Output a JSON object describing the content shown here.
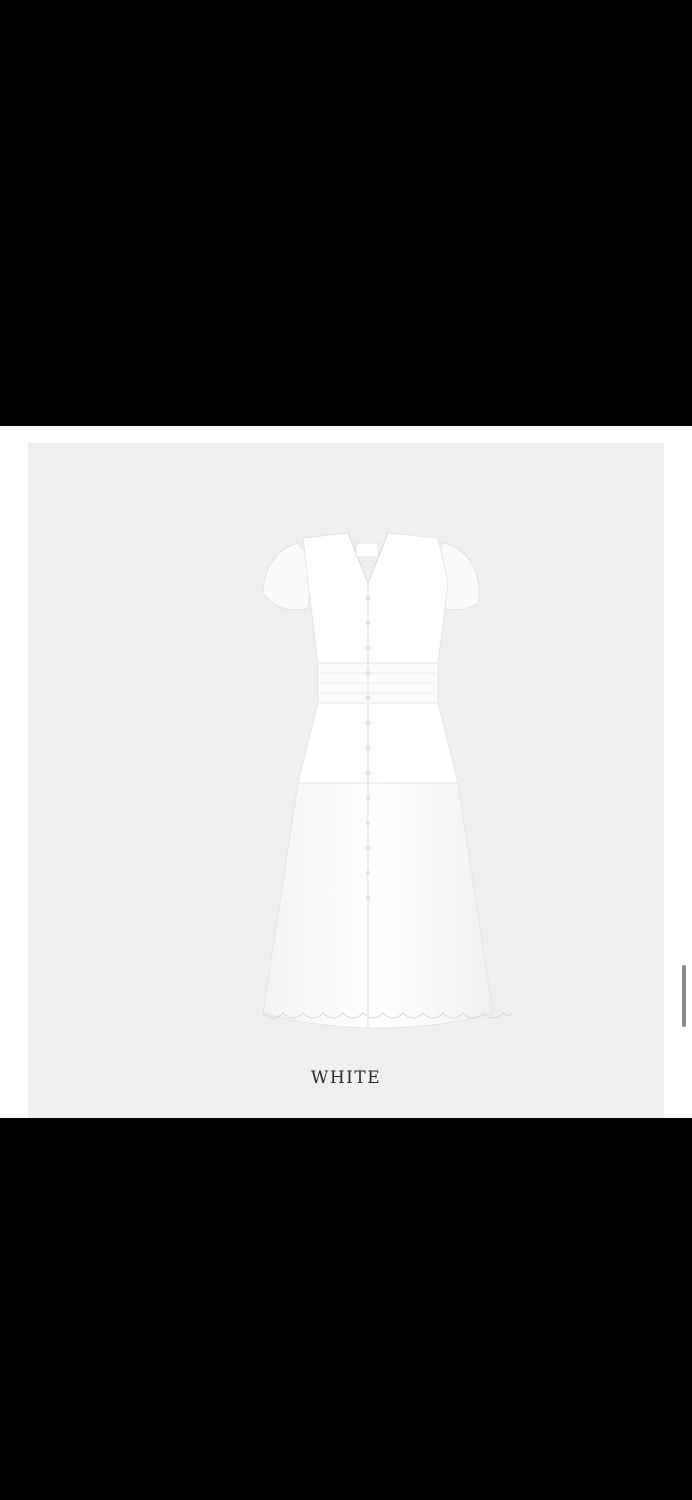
{
  "image": {
    "alt_subject": "dress-photo",
    "caption": "WHITE"
  },
  "colors": {
    "background": "#000000",
    "frame": "#efefef",
    "caption_text": "#2a2a2a",
    "scrollbar": "#8a8a8a"
  }
}
